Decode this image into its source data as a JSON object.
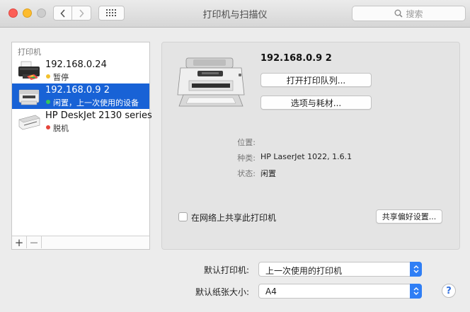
{
  "window": {
    "title": "打印机与扫描仪",
    "search_placeholder": "搜索"
  },
  "printer_list": {
    "header": "打印机",
    "items": [
      {
        "name": "192.168.0.24",
        "status": "暂停",
        "status_color": "#f2c12e",
        "selected": false
      },
      {
        "name": "192.168.0.9 2",
        "status": "闲置，上一次使用的设备",
        "status_color": "#35c759",
        "selected": true
      },
      {
        "name": "HP DeskJet 2130 series",
        "status": "脱机",
        "status_color": "#e5453b",
        "selected": false
      }
    ],
    "add_label": "+",
    "remove_label": "—"
  },
  "detail": {
    "printer_name": "192.168.0.9 2",
    "open_queue_button": "打开打印队列...",
    "options_button": "选项与耗材...",
    "location_label": "位置:",
    "location_value": "",
    "kind_label": "种类:",
    "kind_value": "HP LaserJet 1022, 1.6.1",
    "status_label": "状态:",
    "status_value": "闲置",
    "share_checkbox_label": "在网络上共享此打印机",
    "share_checked": false,
    "sharing_prefs_button": "共享偏好设置..."
  },
  "defaults": {
    "default_printer_label": "默认打印机:",
    "default_printer_value": "上一次使用的打印机",
    "default_paper_label": "默认纸张大小:",
    "default_paper_value": "A4"
  },
  "help_label": "?",
  "colors": {
    "selection": "#1862d6",
    "popup_accent": "#2f7ef5"
  }
}
